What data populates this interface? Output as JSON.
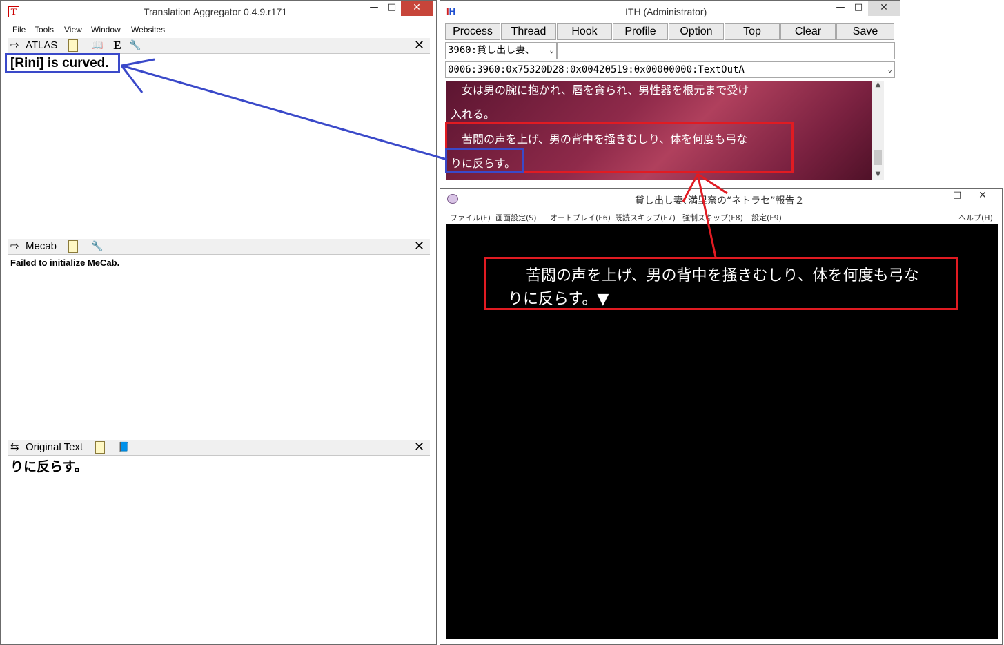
{
  "ta": {
    "title": "Translation Aggregator 0.4.9.r171",
    "app_icon": "T",
    "menu": [
      "File",
      "Tools",
      "View",
      "Window",
      "Websites"
    ],
    "atlas": {
      "name": "ATLAS",
      "text": "[Rini] is curved."
    },
    "mecab": {
      "name": "Mecab",
      "text": "Failed to initialize MeCab."
    },
    "original": {
      "name": "Original Text",
      "text": "りに反らす。"
    }
  },
  "ith": {
    "title": "ITH (Administrator)",
    "buttons": [
      "Process",
      "Thread",
      "Hook",
      "Profile",
      "Option",
      "Top",
      "Clear",
      "Save"
    ],
    "process_combo": "3960:貸し出し妻､",
    "hook_combo": "0006:3960:0x75320D28:0x00420519:0x00000000:TextOutA",
    "lines": [
      "女は男の腕に抱かれ、唇を貪られ、男性器を根元まで受け",
      "入れる。",
      "苦悶の声を上げ、男の背中を掻きむしり、体を何度も弓な",
      "りに反らす。"
    ]
  },
  "game": {
    "title": "貸し出し妻､満里奈の“ネトラセ”報告２",
    "menu": [
      "ファイル(F)",
      "画面設定(S)",
      "オートプレイ(F6)",
      "既読スキップ(F7)",
      "強制スキップ(F8)",
      "設定(F9)",
      "ヘルプ(H)"
    ],
    "line1": "苦悶の声を上げ、男の背中を掻きむしり、体を何度も弓な",
    "line2": "りに反らす。▼"
  },
  "icons": [
    "arrow-right-icon",
    "clipboard-icon",
    "dictionary-icon",
    "e-icon",
    "wrench-icon",
    "close-icon",
    "book-icon"
  ],
  "colors": {
    "highlight_red": "#e11b22",
    "highlight_blue": "#3a49c9",
    "close_button": "#c7453a"
  }
}
